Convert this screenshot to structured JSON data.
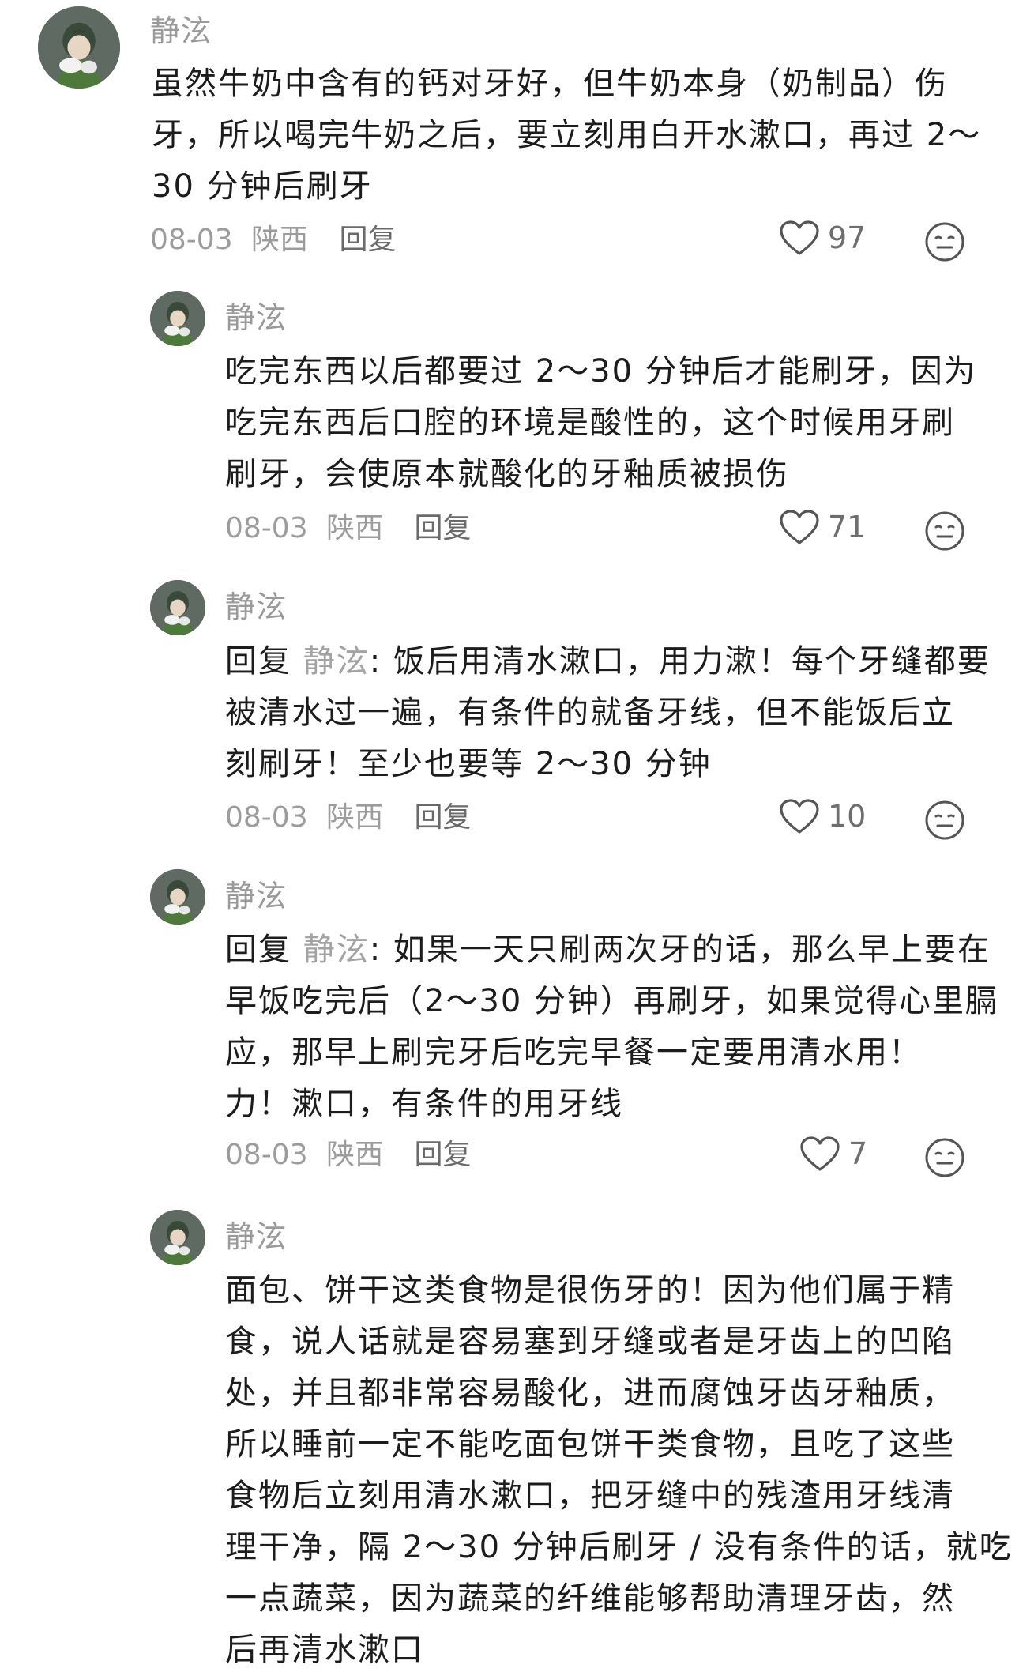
{
  "comments": [
    {
      "username": "静泫",
      "text_lines": [
        "虽然牛奶中含有的钙对牙好，但牛奶本身（奶制品）伤",
        "牙，所以喝完牛奶之后，要立刻用白开水漱口，再过 2～",
        "30 分钟后刷牙"
      ],
      "date": "08-03",
      "location": "陕西",
      "reply_label": "回复",
      "likes": "97"
    },
    {
      "username": "静泫",
      "text_lines": [
        "吃完东西以后都要过 2～30 分钟后才能刷牙，因为",
        "吃完东西后口腔的环境是酸性的，这个时候用牙刷",
        "刷牙，会使原本就酸化的牙釉质被损伤"
      ],
      "date": "08-03",
      "location": "陕西",
      "reply_label": "回复",
      "likes": "71"
    },
    {
      "username": "静泫",
      "reply_prefix": "回复 ",
      "reply_to": "静泫",
      "first_line_rest": ": 饭后用清水漱口，用力漱！每个牙缝都要",
      "text_lines": [
        "被清水过一遍，有条件的就备牙线，但不能饭后立",
        "刻刷牙！至少也要等 2～30 分钟"
      ],
      "date": "08-03",
      "location": "陕西",
      "reply_label": "回复",
      "likes": "10"
    },
    {
      "username": "静泫",
      "reply_prefix": "回复 ",
      "reply_to": "静泫",
      "first_line_rest": ": 如果一天只刷两次牙的话，那么早上要在",
      "text_lines": [
        "早饭吃完后（2～30 分钟）再刷牙，如果觉得心里膈",
        "应，那早上刷完牙后吃完早餐一定要用清水用！",
        "力！漱口，有条件的用牙线"
      ],
      "date": "08-03",
      "location": "陕西",
      "reply_label": "回复",
      "likes": "7"
    },
    {
      "username": "静泫",
      "text_lines": [
        "面包、饼干这类食物是很伤牙的！因为他们属于精",
        "食，说人话就是容易塞到牙缝或者是牙齿上的凹陷",
        "处，并且都非常容易酸化，进而腐蚀牙齿牙釉质，",
        "所以睡前一定不能吃面包饼干类食物，且吃了这些",
        "食物后立刻用清水漱口，把牙缝中的残渣用牙线清",
        "理干净，隔 2～30 分钟后刷牙 / 没有条件的话，就吃",
        "一点蔬菜，因为蔬菜的纤维能够帮助清理牙齿，然",
        "后再清水漱口"
      ]
    }
  ],
  "colors": {
    "username": "#9a9a9a",
    "text": "#1c1c1c",
    "meta": "#9c9c9c",
    "icon_stroke": "#555555"
  },
  "icons": {
    "like": "heart-icon",
    "emoji": "emoji-neutral-icon"
  }
}
